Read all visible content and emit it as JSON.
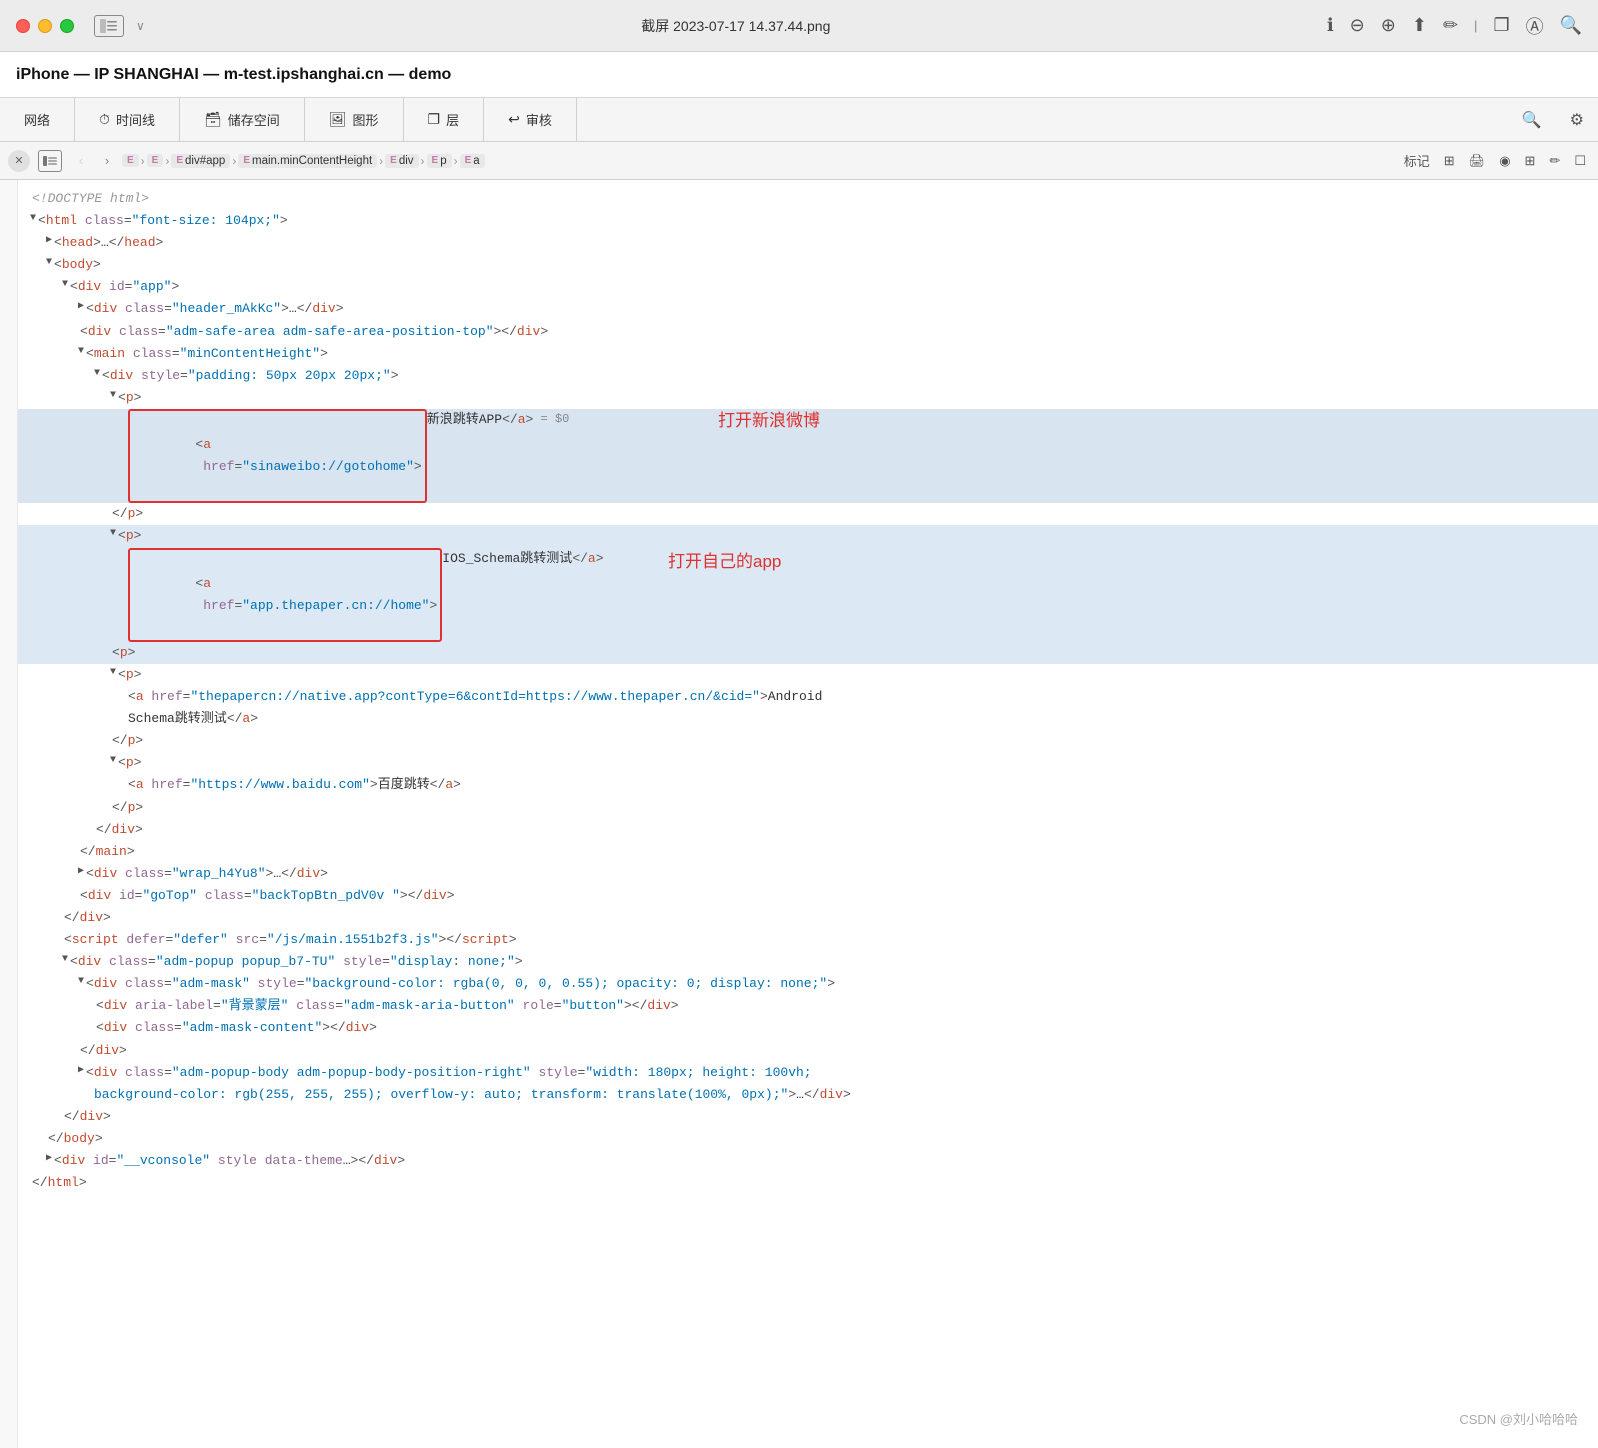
{
  "titleBar": {
    "title": "截屏 2023-07-17 14.37.44.png",
    "actions": [
      "ℹ",
      "⊖",
      "⊕",
      "⬆",
      "✏",
      "❐",
      "Ⓐ",
      "🔍"
    ]
  },
  "deviceBar": {
    "text": "iPhone — IP SHANGHAI — m-test.ipshanghai.cn — demo"
  },
  "tabs": [
    {
      "label": "网络",
      "icon": ""
    },
    {
      "label": "时间线",
      "icon": "⏱"
    },
    {
      "label": "储存空间",
      "icon": "🗃"
    },
    {
      "label": "图形",
      "icon": "🖼"
    },
    {
      "label": "层",
      "icon": "❐"
    },
    {
      "label": "审核",
      "icon": "↩"
    }
  ],
  "breadcrumb": {
    "items": [
      "E",
      "E",
      "div#app",
      "main.minContentHeight",
      "div",
      "p",
      "a"
    ]
  },
  "inspectorActions": [
    "标记",
    "⊞",
    "🖨",
    "◉",
    "⊞",
    "✏",
    "☐"
  ],
  "annotations": {
    "sinaweibo": "打开新浪微博",
    "thepaper": "打开自己的app"
  },
  "watermark": "CSDN @刘小哈哈哈"
}
